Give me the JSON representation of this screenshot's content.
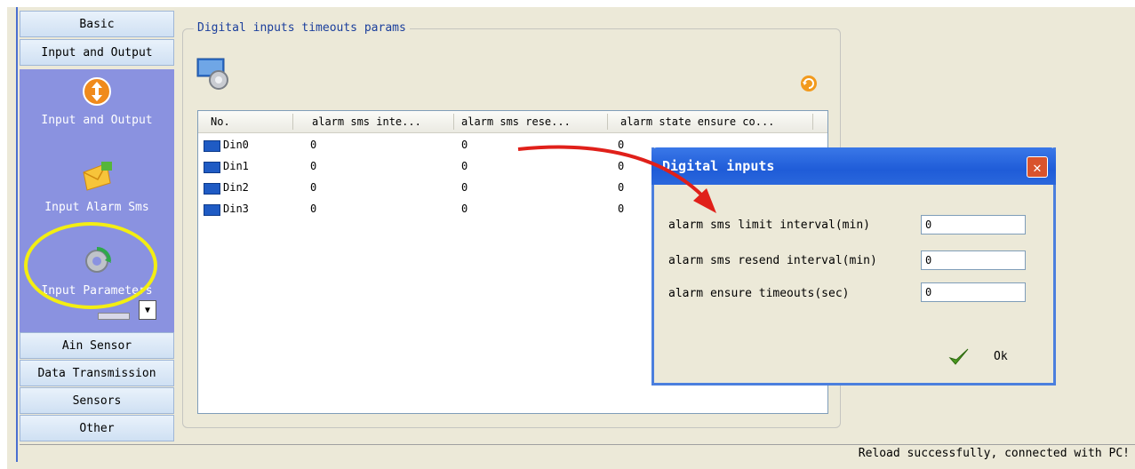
{
  "sidebar": {
    "headers_top": [
      "Basic",
      "Input and Output"
    ],
    "items": [
      {
        "label": "Input and Output",
        "icon": "orange-arrows-icon"
      },
      {
        "label": "Input Alarm Sms",
        "icon": "envelope-icon"
      },
      {
        "label": "Input Parameters",
        "icon": "gear-refresh-icon"
      }
    ],
    "headers_bottom": [
      "Ain Sensor",
      "Data Transmission",
      "Sensors",
      "Other"
    ]
  },
  "group": {
    "title": "Digital inputs timeouts params"
  },
  "table": {
    "columns": [
      "No.",
      "alarm sms inte...",
      "alarm sms rese...",
      "alarm state ensure co..."
    ],
    "rows": [
      [
        "Din0",
        "0",
        "0",
        "0"
      ],
      [
        "Din1",
        "0",
        "0",
        "0"
      ],
      [
        "Din2",
        "0",
        "0",
        "0"
      ],
      [
        "Din3",
        "0",
        "0",
        "0"
      ]
    ]
  },
  "dialog": {
    "title": "Digital inputs",
    "fields": [
      {
        "label": "alarm sms limit interval(min)",
        "value": "0"
      },
      {
        "label": "alarm sms resend interval(min)",
        "value": "0"
      },
      {
        "label": "alarm ensure timeouts(sec)",
        "value": "0"
      }
    ],
    "ok_label": "Ok"
  },
  "status": {
    "text": "Reload successfully, connected with PC!"
  },
  "colors": {
    "panel": "#8a92e0",
    "title_bar": "#1f5cd8",
    "highlight": "#f3ee12",
    "arrow": "#e0201a"
  }
}
